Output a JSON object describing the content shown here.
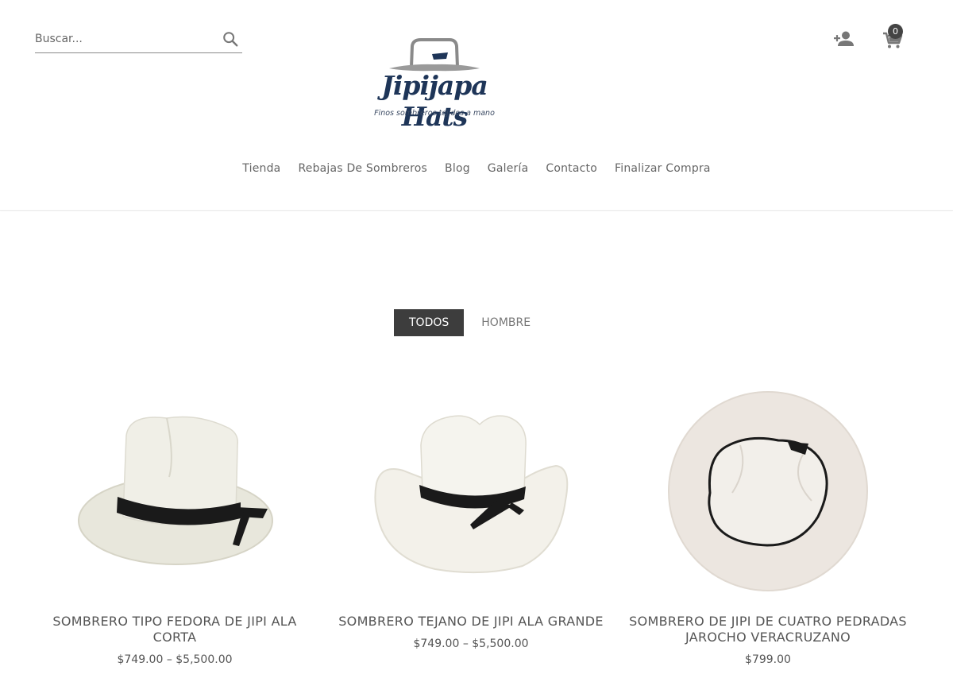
{
  "header": {
    "search": {
      "placeholder": "Buscar..."
    },
    "logo": {
      "brand": "Jipijapa Hats",
      "tagline": "Finos sombreros tejidos a mano"
    },
    "cart_count": "0"
  },
  "nav": {
    "items": [
      {
        "label": "Tienda"
      },
      {
        "label": "Rebajas De Sombreros"
      },
      {
        "label": "Blog"
      },
      {
        "label": "Galería"
      },
      {
        "label": "Contacto"
      },
      {
        "label": "Finalizar Compra"
      }
    ]
  },
  "filters": {
    "active": "TODOS",
    "items": [
      {
        "label": "TODOS"
      },
      {
        "label": "HOMBRE"
      }
    ]
  },
  "products": [
    {
      "title": "SOMBRERO TIPO FEDORA DE JIPI ALA CORTA",
      "price": "$749.00 – $5,500.00"
    },
    {
      "title": "SOMBRERO TEJANO DE JIPI ALA GRANDE",
      "price": "$749.00 – $5,500.00"
    },
    {
      "title": "SOMBRERO DE JIPI DE CUATRO PEDRADAS JAROCHO VERACRUZANO",
      "price": "$799.00"
    }
  ],
  "colors": {
    "accent": "#3d3d3d",
    "brand": "#1e3558",
    "hat_band": "#1a1a1a",
    "straw": "#efeee6"
  },
  "icons": [
    "search-icon",
    "add-user-icon",
    "cart-icon"
  ]
}
